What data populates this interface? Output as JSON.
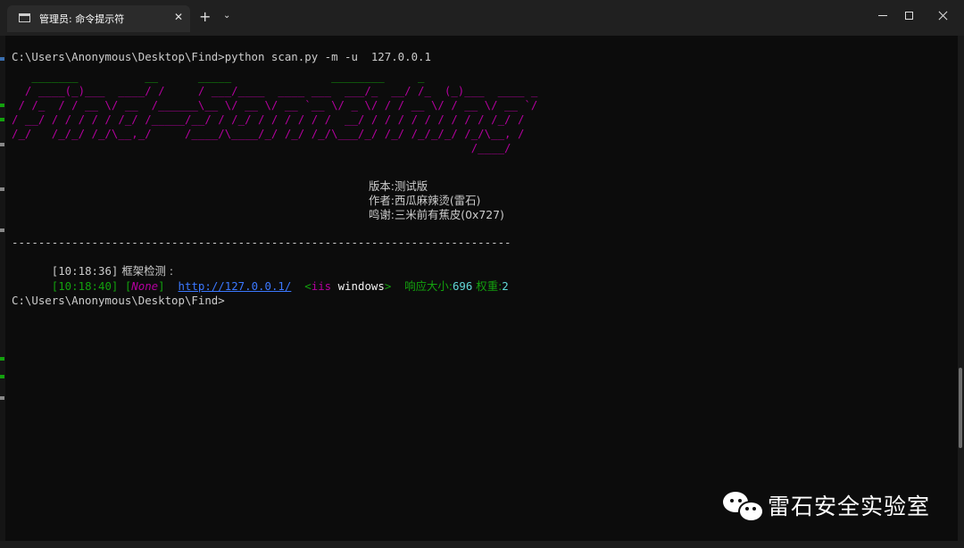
{
  "window": {
    "tab_title": "管理员: 命令提示符",
    "tab_close": "✕",
    "new_tab": "+",
    "tab_dropdown": "⌄"
  },
  "terminal": {
    "prompt_command": "C:\\Users\\Anonymous\\Desktop\\Find>python scan.py -m -u  127.0.0.1",
    "banner_rows": [
      "   _______          __      _____               ________     _",
      "  / ____(_)___  ____/ /     / ___/____  ____ ___  ___/_  __/ /_  (_)___  ____ _",
      " / /_  / / __ \\/ __  /______\\__ \\/ __ \\/ __ `__ \\/ _ \\/ / / __ \\/ / __ \\/ __ `/",
      "/ __/ / / / / / /_/ /_____/__/ / /_/ / / / / / /  __/ / / / / / / / / / /_/ /",
      "/_/   /_/_/ /_/\\__,_/     /____/\\____/_/ /_/ /_/\\___/_/ /_/ /_/_/_/ /_/\\__, /",
      "                                                                     /____/"
    ],
    "info": {
      "version": "版本:测试版",
      "author": "作者:西瓜麻辣烫(雷石)",
      "thanks": "鸣谢:三米前有蕉皮(0x727)"
    },
    "separator": "---------------------------------------------------------------------------",
    "log1": {
      "time": "[10:18:36]",
      "text": " 框架检测 :"
    },
    "log2": {
      "time": "[10:18:40]",
      "bracket_open": " [",
      "none": "None",
      "bracket_close": "]",
      "url": "http://127.0.0.1/",
      "server_open": "<",
      "server_iis": "iis",
      "server_windows": " windows",
      "server_close": ">",
      "size_label": "响应大小:",
      "size_value": "696",
      "weight_label": " 权重:",
      "weight_value": "2"
    },
    "prompt_final": "C:\\Users\\Anonymous\\Desktop\\Find>"
  },
  "watermark": {
    "text": "雷石安全实验室"
  },
  "colors": {
    "green": "#13a10e",
    "magenta": "#b4009e",
    "link": "#3b78ff",
    "cyan": "#61d6d6",
    "background": "#0c0c0c"
  }
}
